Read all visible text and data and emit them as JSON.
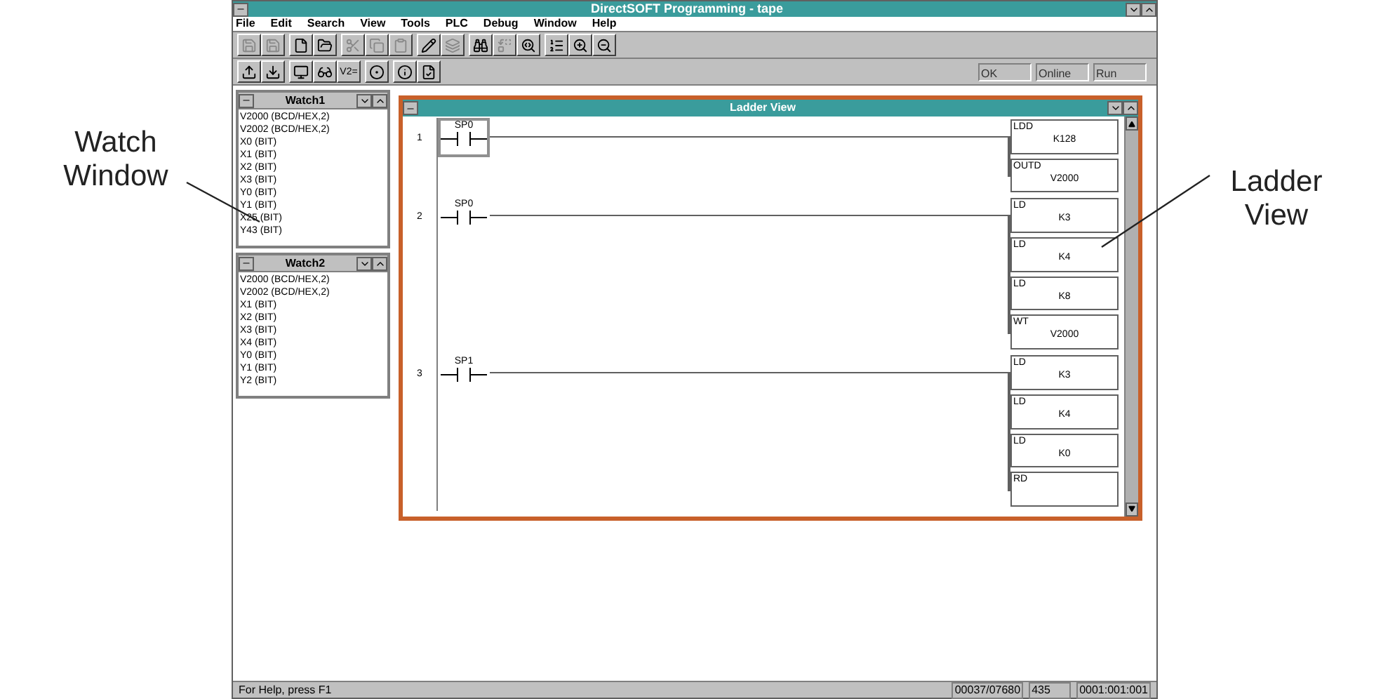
{
  "left_callout": [
    "Watch",
    "Window"
  ],
  "right_callout": [
    "Ladder",
    "View"
  ],
  "window": {
    "title": "DirectSOFT Programming - tape"
  },
  "menu": [
    "File",
    "Edit",
    "Search",
    "View",
    "Tools",
    "PLC",
    "Debug",
    "Window",
    "Help"
  ],
  "toolbar_1": [
    {
      "disabled": true
    },
    {
      "disabled": true
    },
    {
      "disabled": false
    },
    {
      "disabled": false
    },
    {
      "disabled": true
    },
    {
      "disabled": true
    },
    {
      "disabled": true
    },
    {
      "disabled": false
    },
    {
      "disabled": true
    },
    {
      "disabled": false
    },
    {
      "disabled": true
    },
    {
      "disabled": false
    },
    {
      "disabled": false
    },
    {
      "disabled": false
    },
    {
      "disabled": false
    }
  ],
  "toolbar_2": [
    {
      "disabled": false
    },
    {
      "disabled": false
    },
    {
      "disabled": false
    },
    {
      "disabled": false
    },
    {
      "disabled": false,
      "label": "V2="
    },
    {
      "disabled": false
    },
    {
      "disabled": false
    },
    {
      "disabled": false
    }
  ],
  "plc_status": [
    "OK",
    "Online",
    "Run"
  ],
  "watch_windows": [
    {
      "title": "Watch1",
      "items": [
        {
          "address": "V2000",
          "format": "(BCD/HEX,2)"
        },
        {
          "address": "V2002",
          "format": "(BCD/HEX,2)"
        },
        {
          "address": "X0",
          "format": "(BIT)"
        },
        {
          "address": "X1",
          "format": "(BIT)"
        },
        {
          "address": "X2",
          "format": "(BIT)"
        },
        {
          "address": "X3",
          "format": "(BIT)"
        },
        {
          "address": "Y0",
          "format": "(BIT)"
        },
        {
          "address": "Y1",
          "format": "(BIT)"
        },
        {
          "address": "X25",
          "format": "(BIT)"
        },
        {
          "address": "Y43",
          "format": "(BIT)"
        }
      ]
    },
    {
      "title": "Watch2",
      "items": [
        {
          "address": "V2000",
          "format": "(BCD/HEX,2)"
        },
        {
          "address": "V2002",
          "format": "(BCD/HEX,2)"
        },
        {
          "address": "X1",
          "format": "(BIT)"
        },
        {
          "address": "X2",
          "format": "(BIT)"
        },
        {
          "address": "X3",
          "format": "(BIT)"
        },
        {
          "address": "X4",
          "format": "(BIT)"
        },
        {
          "address": "Y0",
          "format": "(BIT)"
        },
        {
          "address": "Y1",
          "format": "(BIT)"
        },
        {
          "address": "Y2",
          "format": "(BIT)"
        }
      ]
    }
  ],
  "ladder_view": {
    "title": "Ladder View",
    "rungs": [
      {
        "number": "1",
        "contact": "SP0",
        "selected": true,
        "boxes": [
          {
            "instruction": "LDD",
            "operand": "K128"
          },
          {
            "instruction": "OUTD",
            "operand": "V2000"
          }
        ]
      },
      {
        "number": "2",
        "contact": "SP0",
        "selected": false,
        "boxes": [
          {
            "instruction": "LD",
            "operand": "K3"
          },
          {
            "instruction": "LD",
            "operand": "K4"
          },
          {
            "instruction": "LD",
            "operand": "K8"
          },
          {
            "instruction": "WT",
            "operand": "V2000"
          }
        ]
      },
      {
        "number": "3",
        "contact": "SP1",
        "selected": false,
        "boxes": [
          {
            "instruction": "LD",
            "operand": "K3"
          },
          {
            "instruction": "LD",
            "operand": "K4"
          },
          {
            "instruction": "LD",
            "operand": "K0"
          },
          {
            "instruction": "RD"
          }
        ]
      }
    ]
  },
  "status_bar": {
    "help": "For Help, press F1",
    "fields": [
      "00037/07680",
      "435",
      "0001:001:001"
    ]
  }
}
